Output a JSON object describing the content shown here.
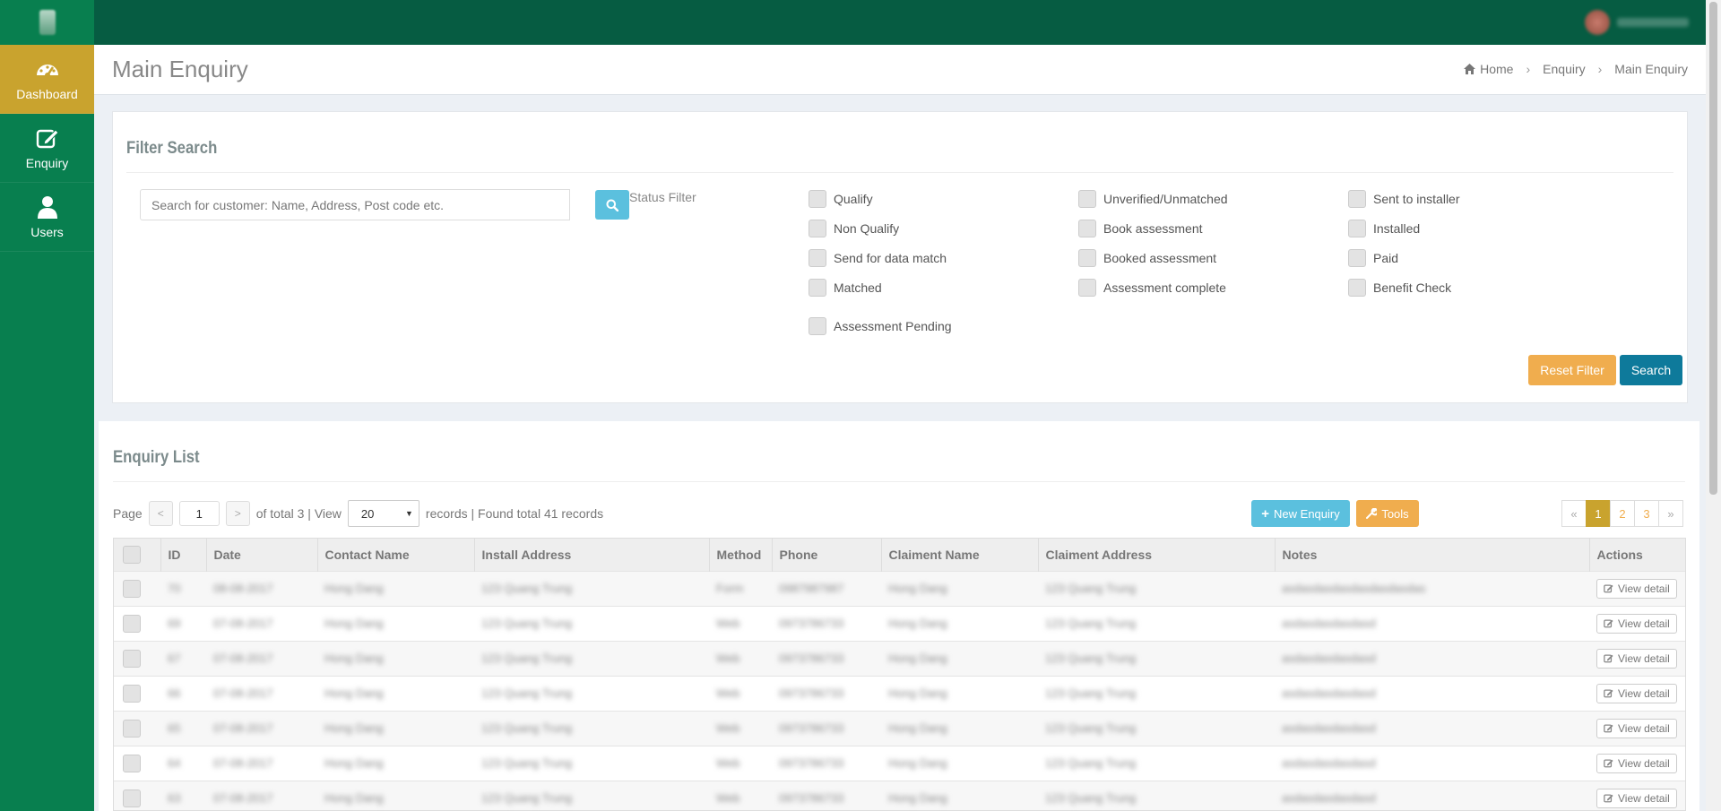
{
  "app": {
    "title": "Main Enquiry"
  },
  "breadcrumb": {
    "home": "Home",
    "level1": "Enquiry",
    "current": "Main Enquiry"
  },
  "sidebar": {
    "items": [
      {
        "label": "Dashboard",
        "icon": "dashboard-icon",
        "active": true
      },
      {
        "label": "Enquiry",
        "icon": "edit-icon",
        "active": false
      },
      {
        "label": "Users",
        "icon": "user-icon",
        "active": false
      }
    ]
  },
  "filter": {
    "title": "Filter Search",
    "search_placeholder": "Search for customer: Name, Address, Post code etc.",
    "status_label": "Status Filter",
    "statuses": {
      "qualify": "Qualify",
      "non_qualify": "Non Qualify",
      "send_data_match": "Send for data match",
      "matched": "Matched",
      "assessment_pending": "Assessment Pending",
      "unverified": "Unverified/Unmatched",
      "book_assessment": "Book assessment",
      "booked_assessment": "Booked assessment",
      "assessment_complete": "Assessment complete",
      "sent_installer": "Sent to installer",
      "installed": "Installed",
      "paid": "Paid",
      "benefit_check": "Benefit Check"
    },
    "reset_label": "Reset Filter",
    "search_label": "Search"
  },
  "list": {
    "title": "Enquiry List",
    "page_label": "Page",
    "page_value": "1",
    "of_total": "of total 3 | View",
    "view_value": "20",
    "records_text": "records | Found total 41 records",
    "new_label": "New Enquiry",
    "tools_label": "Tools",
    "pages": [
      "«",
      "1",
      "2",
      "3",
      "»"
    ],
    "columns": [
      "ID",
      "Date",
      "Contact Name",
      "Install Address",
      "Method",
      "Phone",
      "Claiment Name",
      "Claiment Address",
      "Notes",
      "Actions"
    ],
    "view_detail_label": "View detail",
    "rows": [
      [
        "70",
        "08-08-2017",
        "Hong Dang",
        "123 Quang Trung",
        "Form",
        "0987987987",
        "Hong Dang",
        "123 Quang Trung",
        "asdasdasdasdasdasdasdas"
      ],
      [
        "69",
        "07-08-2017",
        "Hong Dang",
        "123 Quang Trung",
        "Web",
        "0973786733",
        "Hong Dang",
        "123 Quang Trung",
        "asdasdasdasdasd"
      ],
      [
        "67",
        "07-08-2017",
        "Hong Dang",
        "123 Quang Trung",
        "Web",
        "0973786733",
        "Hong Dang",
        "123 Quang Trung",
        "asdasdasdasdasd"
      ],
      [
        "66",
        "07-08-2017",
        "Hong Dang",
        "123 Quang Trung",
        "Web",
        "0973786733",
        "Hong Dang",
        "123 Quang Trung",
        "asdasdasdasdasd"
      ],
      [
        "65",
        "07-08-2017",
        "Hong Dang",
        "123 Quang Trung",
        "Web",
        "0973786733",
        "Hong Dang",
        "123 Quang Trung",
        "asdasdasdasdasd"
      ],
      [
        "64",
        "07-08-2017",
        "Hong Dang",
        "123 Quang Trung",
        "Web",
        "0973786733",
        "Hong Dang",
        "123 Quang Trung",
        "asdasdasdasdasd"
      ],
      [
        "63",
        "07-08-2017",
        "Hong Dang",
        "123 Quang Trung",
        "Web",
        "0973786733",
        "Hong Dang",
        "123 Quang Trung",
        "asdasdasdasdasd"
      ]
    ]
  },
  "colors": {
    "topbar": "#065c42",
    "sidebar": "#087f4f",
    "active": "#c9a32e",
    "info": "#5bc0de",
    "warning": "#f0ad4e",
    "primary": "#0e7a9b"
  }
}
